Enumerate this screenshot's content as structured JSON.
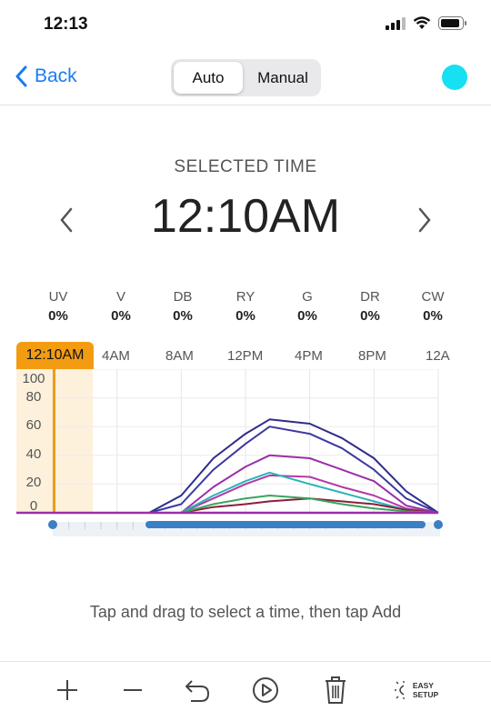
{
  "status_bar": {
    "time": "12:13"
  },
  "nav": {
    "back_label": "Back",
    "mode_tabs": [
      "Auto",
      "Manual"
    ],
    "active_mode": "Auto",
    "status_color": "#17e0f2"
  },
  "selected": {
    "title": "SELECTED TIME",
    "time": "12:10AM"
  },
  "channels": [
    {
      "name": "UV",
      "value": "0%"
    },
    {
      "name": "V",
      "value": "0%"
    },
    {
      "name": "DB",
      "value": "0%"
    },
    {
      "name": "RY",
      "value": "0%"
    },
    {
      "name": "G",
      "value": "0%"
    },
    {
      "name": "DR",
      "value": "0%"
    },
    {
      "name": "CW",
      "value": "0%"
    }
  ],
  "timeline": {
    "selected_label": "12:10AM",
    "labels": [
      "4AM",
      "8AM",
      "12PM",
      "4PM",
      "8PM",
      "12A"
    ],
    "y_labels": [
      "100",
      "80",
      "60",
      "40",
      "20",
      "0"
    ]
  },
  "chart_data": {
    "type": "line",
    "xlabel": "",
    "ylabel": "",
    "x_hours": [
      0,
      6,
      8,
      10,
      12,
      13.5,
      16,
      18,
      20,
      22,
      24
    ],
    "ylim": [
      0,
      100
    ],
    "series": [
      {
        "color": "#2e2c8a",
        "values": [
          0,
          0,
          12,
          38,
          55,
          65,
          62,
          52,
          38,
          15,
          0
        ]
      },
      {
        "color": "#3b3aa0",
        "values": [
          0,
          0,
          6,
          30,
          48,
          60,
          55,
          45,
          30,
          10,
          0
        ]
      },
      {
        "color": "#9b2fa8",
        "values": [
          0,
          0,
          0,
          18,
          32,
          40,
          38,
          30,
          22,
          5,
          0
        ]
      },
      {
        "color": "#b03aa8",
        "values": [
          0,
          0,
          0,
          10,
          20,
          26,
          25,
          18,
          12,
          3,
          0
        ]
      },
      {
        "color": "#2ab3b8",
        "values": [
          0,
          0,
          0,
          12,
          22,
          28,
          20,
          14,
          8,
          2,
          0
        ]
      },
      {
        "color": "#8b1e3a",
        "values": [
          0,
          0,
          0,
          4,
          6,
          8,
          10,
          8,
          6,
          2,
          0
        ]
      },
      {
        "color": "#3aa55a",
        "values": [
          0,
          0,
          0,
          6,
          10,
          12,
          10,
          6,
          3,
          1,
          0
        ]
      }
    ]
  },
  "hint": "Tap and drag to select a time, then tap Add",
  "toolbar": {
    "easy_setup_line1": "EASY",
    "easy_setup_line2": "SETUP"
  }
}
